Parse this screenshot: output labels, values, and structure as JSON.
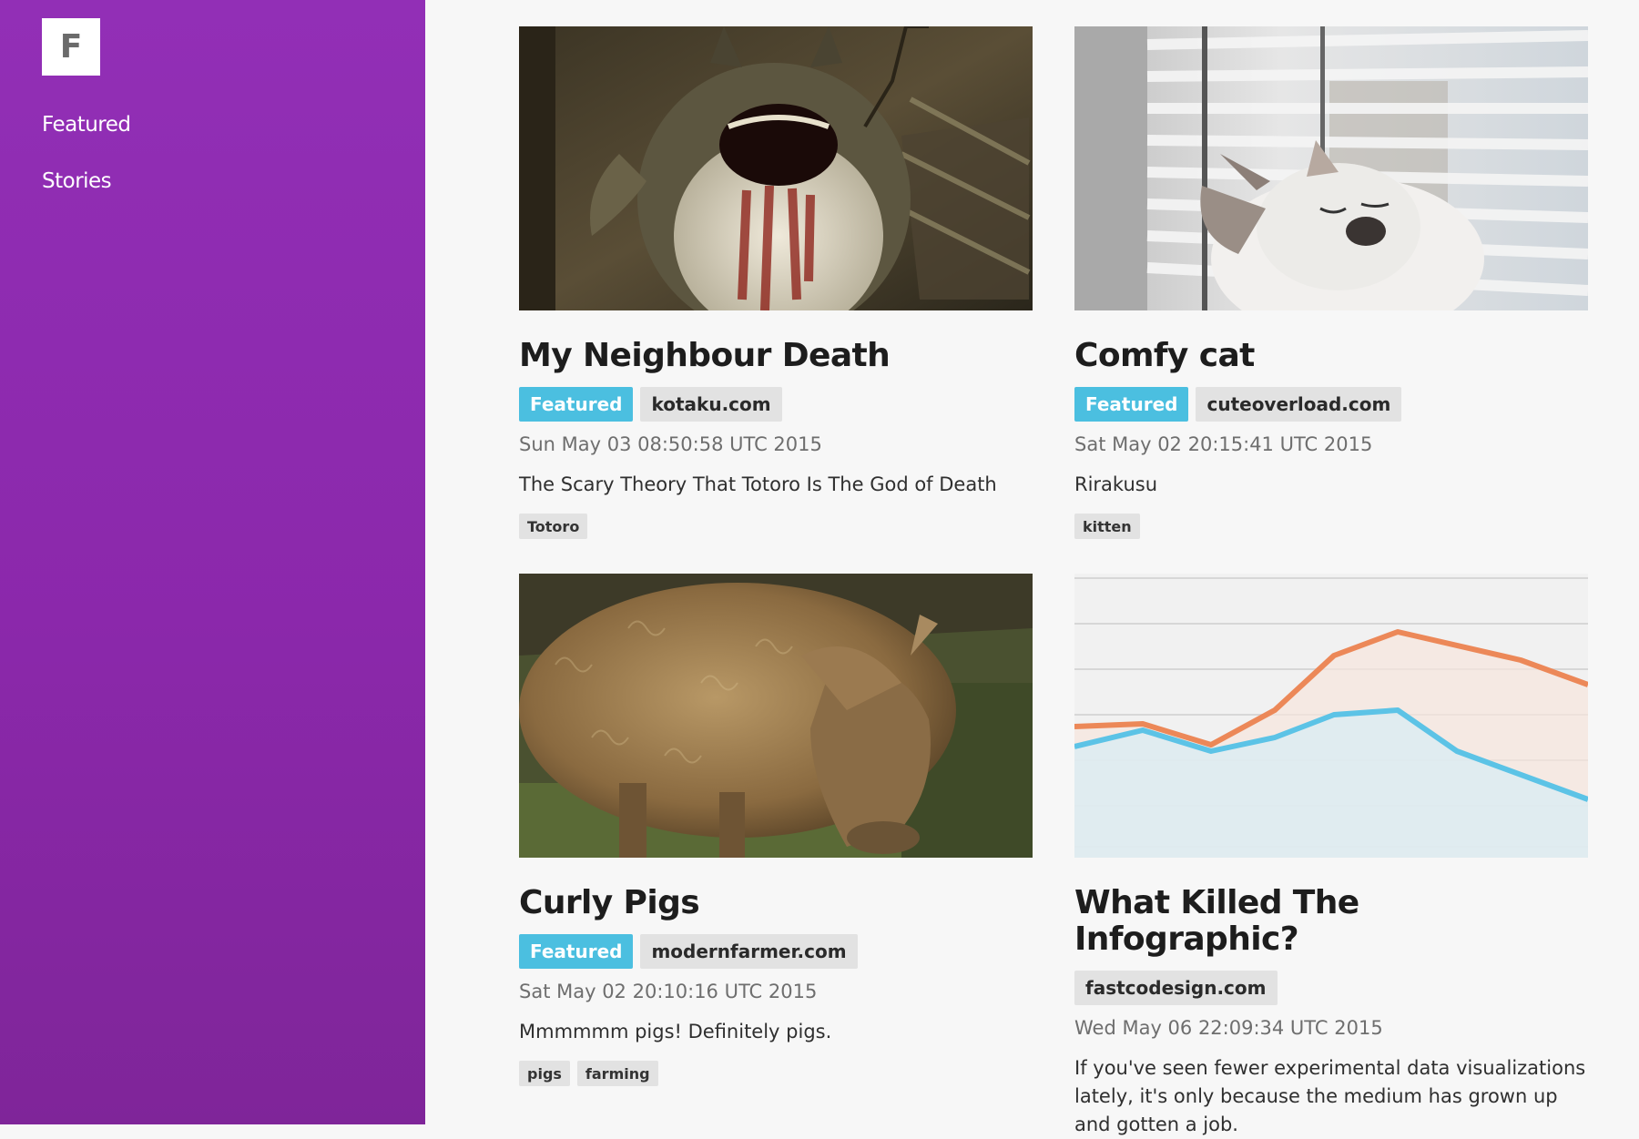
{
  "app": {
    "logo_letter": "F"
  },
  "sidebar": {
    "items": [
      {
        "label": "Featured"
      },
      {
        "label": "Stories"
      }
    ]
  },
  "stories": [
    {
      "title": "My Neighbour Death",
      "featured_label": "Featured",
      "source": "kotaku.com",
      "date": "Sun May 03 08:50:58 UTC 2015",
      "description": "The Scary Theory That Totoro Is The God of Death",
      "tags": [
        "Totoro"
      ]
    },
    {
      "title": "Comfy cat",
      "featured_label": "Featured",
      "source": "cuteoverload.com",
      "date": "Sat May 02 20:15:41 UTC 2015",
      "description": "Rirakusu",
      "tags": [
        "kitten"
      ]
    },
    {
      "title": "Curly Pigs",
      "featured_label": "Featured",
      "source": "modernfarmer.com",
      "date": "Sat May 02 20:10:16 UTC 2015",
      "description": "Mmmmmm pigs! Definitely pigs.",
      "tags": [
        "pigs",
        "farming"
      ]
    },
    {
      "title": "What Killed The Infographic?",
      "source": "fastcodesign.com",
      "date": "Wed May 06 22:09:34 UTC 2015",
      "description": "If you've seen fewer experimental data visualizations lately, it's only because the medium has grown up and gotten a job.",
      "tags": []
    }
  ],
  "colors": {
    "sidebar": "#922fb6",
    "featured_badge": "#4bbfe0",
    "chip": "#e2e2e2"
  }
}
